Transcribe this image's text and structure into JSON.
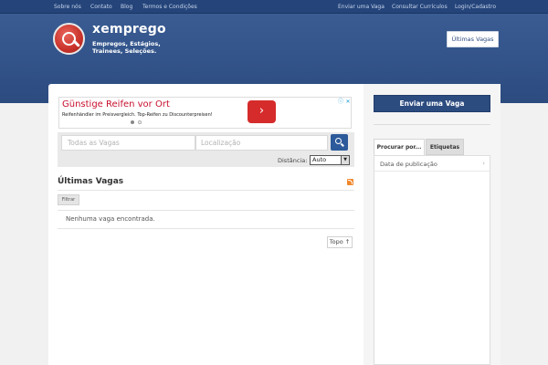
{
  "topnav": {
    "left": [
      "Sobre nós",
      "Contato",
      "Blog",
      "Termos e Condições"
    ],
    "right": [
      "Enviar uma Vaga",
      "Consultar Currículos",
      "Login/Cadastro"
    ]
  },
  "header": {
    "brand": "xemprego",
    "tagline": "Empregos, Estágios, Trainees, Seleções.",
    "ultimas_button": "Últimas Vagas"
  },
  "ad": {
    "title": "Günstige Reifen vor Ort",
    "description": "Reifenhändler im Preisvergleich. Top-Reifen zu Discounterpreisen!",
    "arrow": "›",
    "info_symbol": "ⓘ",
    "close_symbol": "✕"
  },
  "search": {
    "keyword_placeholder": "Todas as Vagas",
    "location_placeholder": "Localização",
    "distance_label": "Distância:",
    "distance_value": "Auto"
  },
  "listing": {
    "title": "Últimas Vagas",
    "filter_label": "Filtrar",
    "empty_message": "Nenhuma vaga encontrada.",
    "top_button": "Topo ↑"
  },
  "sidebar": {
    "enviar_button": "Enviar uma Vaga",
    "tabs": [
      "Procurar por...",
      "Etiquetas"
    ],
    "items": [
      "Data de publicação"
    ]
  },
  "colors": {
    "nav_bg": "#24447a",
    "header_bg": "#325389",
    "accent_button": "#2c4b7f",
    "ad_red": "#d62b2b"
  }
}
